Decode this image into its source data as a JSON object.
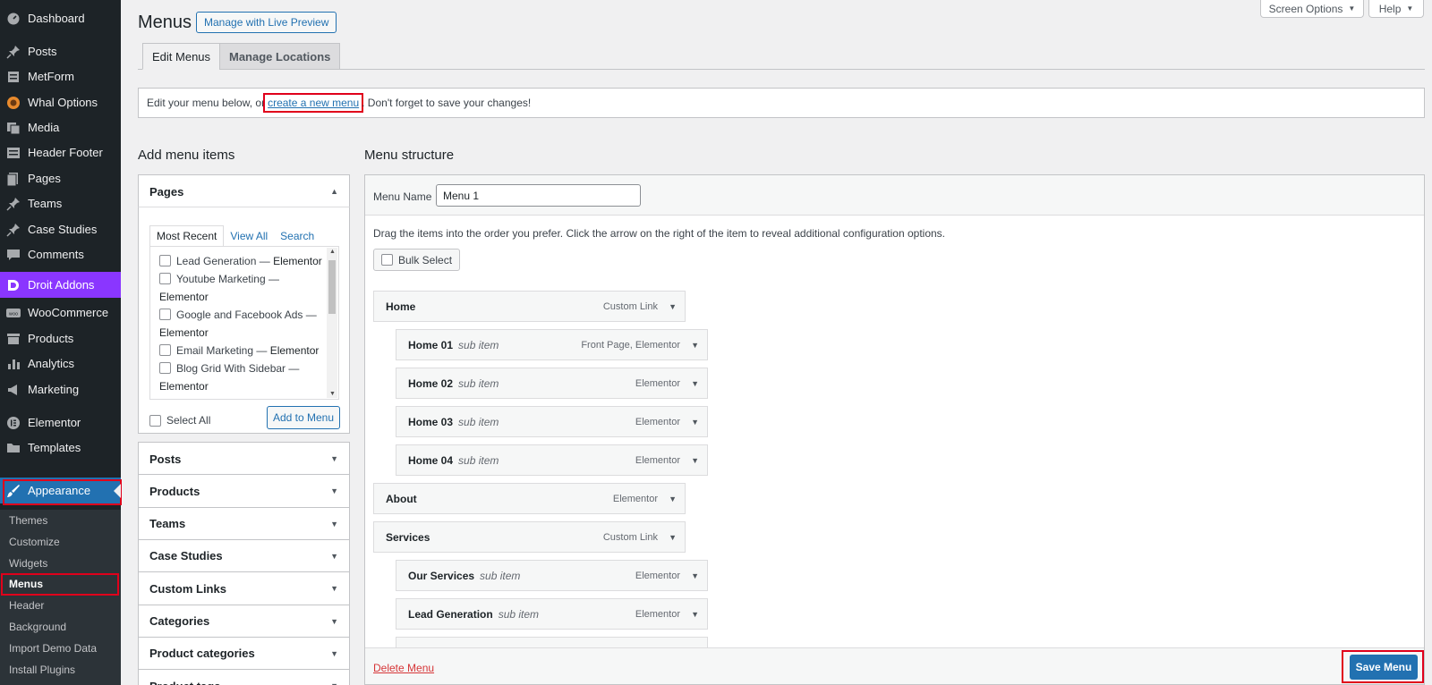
{
  "sidebar": {
    "items": [
      {
        "label": "Dashboard",
        "icon": "dashboard-icon"
      },
      {
        "label": "Posts",
        "icon": "pin-icon"
      },
      {
        "label": "MetForm",
        "icon": "form-icon"
      },
      {
        "label": "Whal Options",
        "icon": "whal-icon"
      },
      {
        "label": "Media",
        "icon": "media-icon"
      },
      {
        "label": "Header Footer",
        "icon": "layout-icon"
      },
      {
        "label": "Pages",
        "icon": "pages-icon"
      },
      {
        "label": "Teams",
        "icon": "pin-icon"
      },
      {
        "label": "Case Studies",
        "icon": "pin-icon"
      },
      {
        "label": "Comments",
        "icon": "comment-icon"
      },
      {
        "label": "Droit Addons",
        "icon": "droit-icon"
      },
      {
        "label": "WooCommerce",
        "icon": "woo-icon"
      },
      {
        "label": "Products",
        "icon": "products-icon"
      },
      {
        "label": "Analytics",
        "icon": "chart-icon"
      },
      {
        "label": "Marketing",
        "icon": "megaphone-icon"
      },
      {
        "label": "Elementor",
        "icon": "elementor-icon"
      },
      {
        "label": "Templates",
        "icon": "folder-icon"
      },
      {
        "label": "Appearance",
        "icon": "brush-icon"
      }
    ],
    "submenu": [
      "Themes",
      "Customize",
      "Widgets",
      "Menus",
      "Header",
      "Background",
      "Import Demo Data",
      "Install Plugins"
    ],
    "accent": "#2271b1",
    "droit_color": "#8a36ff"
  },
  "header": {
    "title": "Menus",
    "live_preview": "Manage with Live Preview",
    "screen_options": "Screen Options",
    "help": "Help",
    "tabs": [
      "Edit Menus",
      "Manage Locations"
    ]
  },
  "notice": {
    "before": "Edit your menu below, or",
    "link": "create a new menu",
    "after": ". Don't forget to save your changes!"
  },
  "add_items": {
    "title": "Add menu items",
    "pages": {
      "label": "Pages",
      "tabs": [
        "Most Recent",
        "View All",
        "Search"
      ],
      "items": [
        {
          "name": "Lead Generation",
          "sep": " — ",
          "builder": "Elementor"
        },
        {
          "name": "Youtube Marketing",
          "sep": " — ",
          "builder": "Elementor"
        },
        {
          "name": "Google and Facebook Ads",
          "sep": " — ",
          "builder": "Elementor"
        },
        {
          "name": "Email Marketing",
          "sep": " — ",
          "builder": "Elementor"
        },
        {
          "name": "Blog Grid With Sidebar",
          "sep": " — ",
          "builder": "Elementor"
        }
      ],
      "select_all": "Select All",
      "add_button": "Add to Menu"
    },
    "sections": [
      "Posts",
      "Products",
      "Teams",
      "Case Studies",
      "Custom Links",
      "Categories",
      "Product categories",
      "Product tags"
    ]
  },
  "structure": {
    "title": "Menu structure",
    "name_label": "Menu Name",
    "name_value": "Menu 1",
    "instructions": "Drag the items into the order you prefer. Click the arrow on the right of the item to reveal additional configuration options.",
    "bulk_select": "Bulk Select",
    "items": [
      {
        "title": "Home",
        "sub": "",
        "type": "Custom Link",
        "depth": 0
      },
      {
        "title": "Home 01",
        "sub": "sub item",
        "type": "Front Page, Elementor",
        "depth": 1
      },
      {
        "title": "Home 02",
        "sub": "sub item",
        "type": "Elementor",
        "depth": 1
      },
      {
        "title": "Home 03",
        "sub": "sub item",
        "type": "Elementor",
        "depth": 1
      },
      {
        "title": "Home 04",
        "sub": "sub item",
        "type": "Elementor",
        "depth": 1
      },
      {
        "title": "About",
        "sub": "",
        "type": "Elementor",
        "depth": 0
      },
      {
        "title": "Services",
        "sub": "",
        "type": "Custom Link",
        "depth": 0
      },
      {
        "title": "Our Services",
        "sub": "sub item",
        "type": "Elementor",
        "depth": 1
      },
      {
        "title": "Lead Generation",
        "sub": "sub item",
        "type": "Elementor",
        "depth": 1
      }
    ],
    "delete": "Delete Menu",
    "save": "Save Menu"
  }
}
